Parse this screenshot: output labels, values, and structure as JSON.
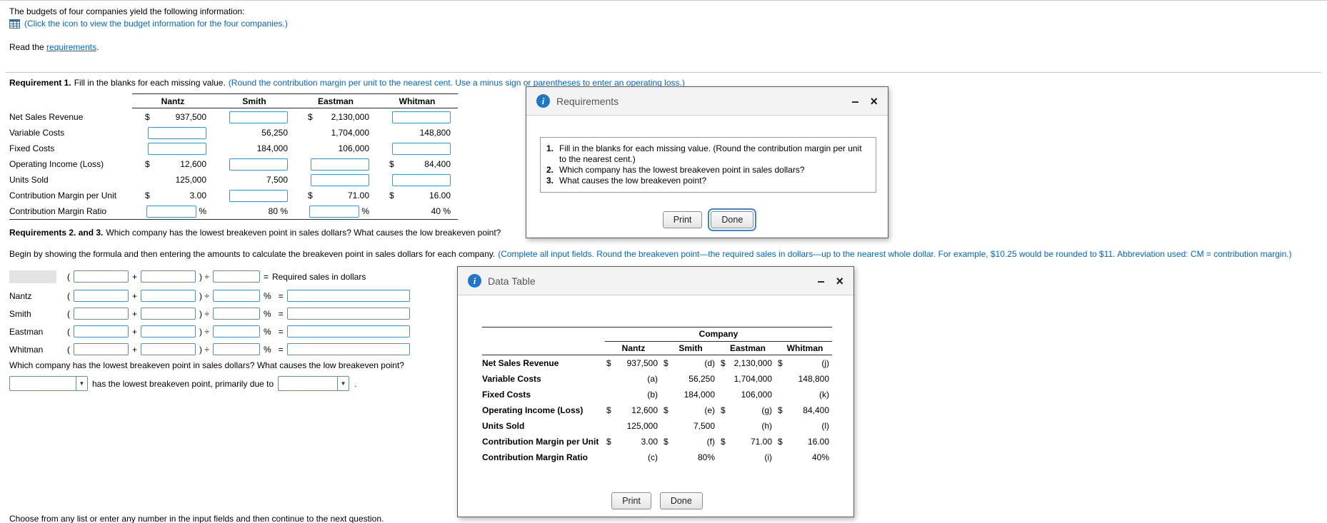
{
  "colors": {
    "link_blue": "#0066cc",
    "instruction_blue": "#0066cc",
    "input_border_blue": "#4c8fce",
    "info_icon_blue": "#2077c8",
    "focus_ring_blue": "#3d87d6",
    "dialog_bar_gray": "#f3f3f3"
  },
  "intro": {
    "statement": "The budgets of four companies yield the following information:",
    "icon_caption": "(Click the icon to view the budget information for the four companies.)",
    "read_prefix": "Read the ",
    "read_link": "requirements",
    "read_period": "."
  },
  "requirement1": {
    "label": "Requirement 1.",
    "text": "Fill in the blanks for each missing value.",
    "note": "(Round the contribution margin per unit to the nearest cent. Use a minus sign or parentheses to enter an operating loss.)",
    "columns": [
      "Nantz",
      "Smith",
      "Eastman",
      "Whitman"
    ],
    "rows": [
      {
        "label": "Net Sales Revenue",
        "cells": [
          {
            "dollar": "$",
            "value": "937,500"
          },
          {
            "input": true
          },
          {
            "dollar": "$",
            "value": "2,130,000"
          },
          {
            "input": true
          }
        ]
      },
      {
        "label": "Variable Costs",
        "cells": [
          {
            "input": true
          },
          {
            "value": "56,250"
          },
          {
            "value": "1,704,000"
          },
          {
            "value": "148,800"
          }
        ]
      },
      {
        "label": "Fixed Costs",
        "cells": [
          {
            "input": true
          },
          {
            "value": "184,000"
          },
          {
            "value": "106,000"
          },
          {
            "input": true
          }
        ]
      },
      {
        "label": "Operating Income (Loss)",
        "cells": [
          {
            "dollar": "$",
            "value": "12,600"
          },
          {
            "input": true
          },
          {
            "input": true
          },
          {
            "dollar": "$",
            "value": "84,400"
          }
        ]
      },
      {
        "label": "Units Sold",
        "cells": [
          {
            "value": "125,000"
          },
          {
            "value": "7,500"
          },
          {
            "input": true
          },
          {
            "input": true
          }
        ]
      },
      {
        "label": "Contribution Margin per Unit",
        "cells": [
          {
            "dollar": "$",
            "value": "3.00"
          },
          {
            "input": true
          },
          {
            "dollar": "$",
            "value": "71.00"
          },
          {
            "dollar": "$",
            "value": "16.00"
          }
        ]
      },
      {
        "label": "Contribution Margin Ratio",
        "cells": [
          {
            "input": true,
            "suffix": "%"
          },
          {
            "value": "80 %"
          },
          {
            "input": true,
            "suffix": "%"
          },
          {
            "value": "40 %"
          }
        ]
      }
    ]
  },
  "requirements23": {
    "label": "Requirements 2. and 3.",
    "text": "Which company has the lowest breakeven point in sales dollars? What causes the low breakeven point?",
    "begin_text": "Begin by showing the formula and then entering the amounts to calculate the breakeven point in sales dollars for each company.",
    "begin_note": "(Complete all input fields. Round the breakeven point—the required sales in dollars—up to the nearest whole dollar. For example, $10.25 would be rounded to $11. Abbreviation used: CM = contribution margin.)"
  },
  "breakeven_formula": {
    "symbols": {
      "open": "(",
      "plus": "+",
      "close_divide": ") ÷",
      "percent": "%",
      "equals": "="
    },
    "result_label": "Required sales in dollars",
    "companies": [
      "Nantz",
      "Smith",
      "Eastman",
      "Whitman"
    ]
  },
  "lowest_question": {
    "text": "Which company has the lowest breakeven point in sales dollars? What causes the low breakeven point?",
    "middle_text": "has the lowest breakeven point, primarily due to",
    "period": ".",
    "arrow": "▼"
  },
  "footer_note": "Choose from any list or enter any number in the input fields and then continue to the next question.",
  "requirements_dialog": {
    "title": "Requirements",
    "minimize_glyph": "–",
    "close_glyph": "×",
    "items": [
      {
        "num": "1.",
        "text": "Fill in the blanks for each missing value. (Round the contribution margin per unit to the nearest cent.)"
      },
      {
        "num": "2.",
        "text": "Which company has the lowest breakeven point in sales dollars?"
      },
      {
        "num": "3.",
        "text": "What causes the low breakeven point?"
      }
    ],
    "print_label": "Print",
    "done_label": "Done"
  },
  "data_table_dialog": {
    "title": "Data Table",
    "minimize_glyph": "–",
    "close_glyph": "×",
    "company_header": "Company",
    "columns": [
      "Nantz",
      "Smith",
      "Eastman",
      "Whitman"
    ],
    "rows": [
      {
        "label": "Net Sales Revenue",
        "cells": [
          {
            "dollar": "$",
            "value": "937,500"
          },
          {
            "dollar": "$",
            "value": "(d)"
          },
          {
            "dollar": "$",
            "value": "2,130,000"
          },
          {
            "dollar": "$",
            "value": "(j)"
          }
        ]
      },
      {
        "label": "Variable Costs",
        "cells": [
          {
            "value": "(a)"
          },
          {
            "value": "56,250"
          },
          {
            "value": "1,704,000"
          },
          {
            "value": "148,800"
          }
        ]
      },
      {
        "label": "Fixed Costs",
        "cells": [
          {
            "value": "(b)"
          },
          {
            "value": "184,000"
          },
          {
            "value": "106,000"
          },
          {
            "value": "(k)"
          }
        ]
      },
      {
        "label": "Operating Income (Loss)",
        "cells": [
          {
            "dollar": "$",
            "value": "12,600"
          },
          {
            "dollar": "$",
            "value": "(e)"
          },
          {
            "dollar": "$",
            "value": "(g)"
          },
          {
            "dollar": "$",
            "value": "84,400"
          }
        ]
      },
      {
        "label": "Units Sold",
        "cells": [
          {
            "value": "125,000"
          },
          {
            "value": "7,500"
          },
          {
            "value": "(h)"
          },
          {
            "value": "(l)"
          }
        ]
      },
      {
        "label": "Contribution Margin per Unit",
        "cells": [
          {
            "dollar": "$",
            "value": "3.00"
          },
          {
            "dollar": "$",
            "value": "(f)"
          },
          {
            "dollar": "$",
            "value": "71.00"
          },
          {
            "dollar": "$",
            "value": "16.00"
          }
        ]
      },
      {
        "label": "Contribution Margin Ratio",
        "cells": [
          {
            "value": "(c)"
          },
          {
            "value": "80%"
          },
          {
            "value": "(i)"
          },
          {
            "value": "40%"
          }
        ]
      }
    ],
    "print_label": "Print",
    "done_label": "Done"
  }
}
